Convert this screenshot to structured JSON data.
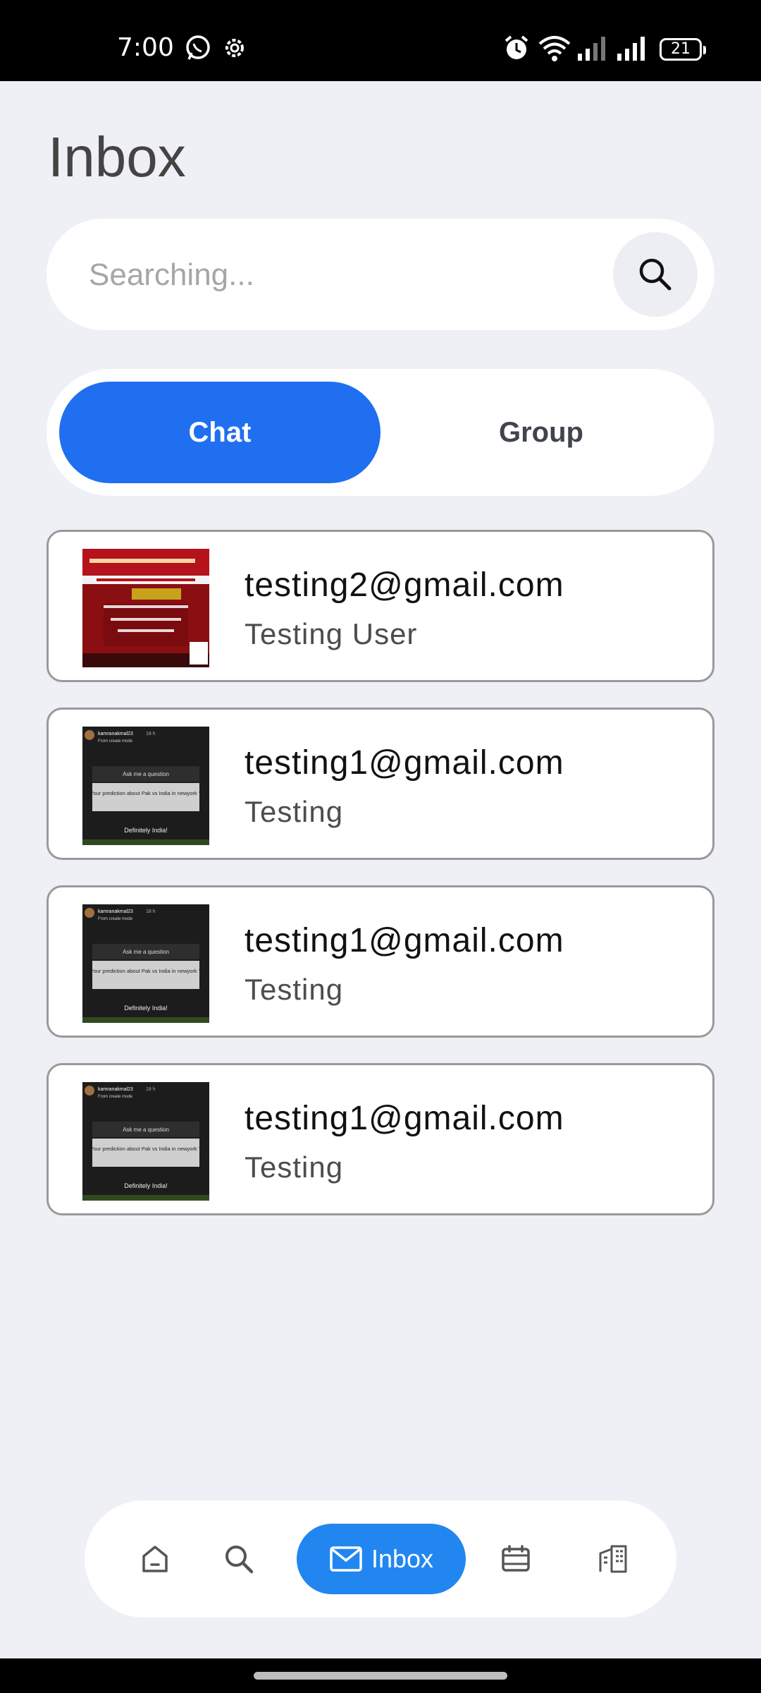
{
  "status_bar": {
    "time": "7:00",
    "battery": "21",
    "icons": [
      "whatsapp-icon",
      "settings-icon",
      "alarm-icon",
      "wifi-icon",
      "signal-icon",
      "signal-icon"
    ]
  },
  "page": {
    "title": "Inbox"
  },
  "search": {
    "placeholder": "Searching..."
  },
  "tabs": {
    "chat": "Chat",
    "group": "Group",
    "active": "Chat"
  },
  "chats": [
    {
      "email": "testing2@gmail.com",
      "name": "Testing User",
      "thumb": "news"
    },
    {
      "email": "testing1@gmail.com",
      "name": "Testing",
      "thumb": "story"
    },
    {
      "email": "testing1@gmail.com",
      "name": "Testing",
      "thumb": "story"
    },
    {
      "email": "testing1@gmail.com",
      "name": "Testing",
      "thumb": "story"
    }
  ],
  "thumb_story": {
    "username": "kamranakmal23",
    "time": "18 h",
    "subtitle": "From create mode",
    "ask": "Ask me a question",
    "question": "Your prediction about Pak vs India in newyork ?",
    "answer": "Definitely India!"
  },
  "bottom_nav": {
    "inbox_label": "Inbox"
  },
  "colors": {
    "accent": "#1f6ff0",
    "nav_accent": "#2286f0",
    "background": "#eef0f6"
  }
}
